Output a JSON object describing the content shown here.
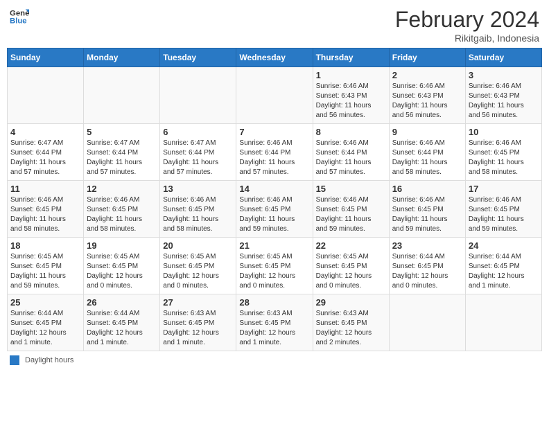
{
  "header": {
    "logo_line1": "General",
    "logo_line2": "Blue",
    "main_title": "February 2024",
    "sub_title": "Rikitgaib, Indonesia"
  },
  "weekdays": [
    "Sunday",
    "Monday",
    "Tuesday",
    "Wednesday",
    "Thursday",
    "Friday",
    "Saturday"
  ],
  "weeks": [
    {
      "days": [
        {
          "num": "",
          "info": ""
        },
        {
          "num": "",
          "info": ""
        },
        {
          "num": "",
          "info": ""
        },
        {
          "num": "",
          "info": ""
        },
        {
          "num": "1",
          "info": "Sunrise: 6:46 AM\nSunset: 6:43 PM\nDaylight: 11 hours\nand 56 minutes."
        },
        {
          "num": "2",
          "info": "Sunrise: 6:46 AM\nSunset: 6:43 PM\nDaylight: 11 hours\nand 56 minutes."
        },
        {
          "num": "3",
          "info": "Sunrise: 6:46 AM\nSunset: 6:43 PM\nDaylight: 11 hours\nand 56 minutes."
        }
      ]
    },
    {
      "days": [
        {
          "num": "4",
          "info": "Sunrise: 6:47 AM\nSunset: 6:44 PM\nDaylight: 11 hours\nand 57 minutes."
        },
        {
          "num": "5",
          "info": "Sunrise: 6:47 AM\nSunset: 6:44 PM\nDaylight: 11 hours\nand 57 minutes."
        },
        {
          "num": "6",
          "info": "Sunrise: 6:47 AM\nSunset: 6:44 PM\nDaylight: 11 hours\nand 57 minutes."
        },
        {
          "num": "7",
          "info": "Sunrise: 6:46 AM\nSunset: 6:44 PM\nDaylight: 11 hours\nand 57 minutes."
        },
        {
          "num": "8",
          "info": "Sunrise: 6:46 AM\nSunset: 6:44 PM\nDaylight: 11 hours\nand 57 minutes."
        },
        {
          "num": "9",
          "info": "Sunrise: 6:46 AM\nSunset: 6:44 PM\nDaylight: 11 hours\nand 58 minutes."
        },
        {
          "num": "10",
          "info": "Sunrise: 6:46 AM\nSunset: 6:45 PM\nDaylight: 11 hours\nand 58 minutes."
        }
      ]
    },
    {
      "days": [
        {
          "num": "11",
          "info": "Sunrise: 6:46 AM\nSunset: 6:45 PM\nDaylight: 11 hours\nand 58 minutes."
        },
        {
          "num": "12",
          "info": "Sunrise: 6:46 AM\nSunset: 6:45 PM\nDaylight: 11 hours\nand 58 minutes."
        },
        {
          "num": "13",
          "info": "Sunrise: 6:46 AM\nSunset: 6:45 PM\nDaylight: 11 hours\nand 58 minutes."
        },
        {
          "num": "14",
          "info": "Sunrise: 6:46 AM\nSunset: 6:45 PM\nDaylight: 11 hours\nand 59 minutes."
        },
        {
          "num": "15",
          "info": "Sunrise: 6:46 AM\nSunset: 6:45 PM\nDaylight: 11 hours\nand 59 minutes."
        },
        {
          "num": "16",
          "info": "Sunrise: 6:46 AM\nSunset: 6:45 PM\nDaylight: 11 hours\nand 59 minutes."
        },
        {
          "num": "17",
          "info": "Sunrise: 6:46 AM\nSunset: 6:45 PM\nDaylight: 11 hours\nand 59 minutes."
        }
      ]
    },
    {
      "days": [
        {
          "num": "18",
          "info": "Sunrise: 6:45 AM\nSunset: 6:45 PM\nDaylight: 11 hours\nand 59 minutes."
        },
        {
          "num": "19",
          "info": "Sunrise: 6:45 AM\nSunset: 6:45 PM\nDaylight: 12 hours\nand 0 minutes."
        },
        {
          "num": "20",
          "info": "Sunrise: 6:45 AM\nSunset: 6:45 PM\nDaylight: 12 hours\nand 0 minutes."
        },
        {
          "num": "21",
          "info": "Sunrise: 6:45 AM\nSunset: 6:45 PM\nDaylight: 12 hours\nand 0 minutes."
        },
        {
          "num": "22",
          "info": "Sunrise: 6:45 AM\nSunset: 6:45 PM\nDaylight: 12 hours\nand 0 minutes."
        },
        {
          "num": "23",
          "info": "Sunrise: 6:44 AM\nSunset: 6:45 PM\nDaylight: 12 hours\nand 0 minutes."
        },
        {
          "num": "24",
          "info": "Sunrise: 6:44 AM\nSunset: 6:45 PM\nDaylight: 12 hours\nand 1 minute."
        }
      ]
    },
    {
      "days": [
        {
          "num": "25",
          "info": "Sunrise: 6:44 AM\nSunset: 6:45 PM\nDaylight: 12 hours\nand 1 minute."
        },
        {
          "num": "26",
          "info": "Sunrise: 6:44 AM\nSunset: 6:45 PM\nDaylight: 12 hours\nand 1 minute."
        },
        {
          "num": "27",
          "info": "Sunrise: 6:43 AM\nSunset: 6:45 PM\nDaylight: 12 hours\nand 1 minute."
        },
        {
          "num": "28",
          "info": "Sunrise: 6:43 AM\nSunset: 6:45 PM\nDaylight: 12 hours\nand 1 minute."
        },
        {
          "num": "29",
          "info": "Sunrise: 6:43 AM\nSunset: 6:45 PM\nDaylight: 12 hours\nand 2 minutes."
        },
        {
          "num": "",
          "info": ""
        },
        {
          "num": "",
          "info": ""
        }
      ]
    }
  ],
  "footer": {
    "legend_label": "Daylight hours"
  }
}
